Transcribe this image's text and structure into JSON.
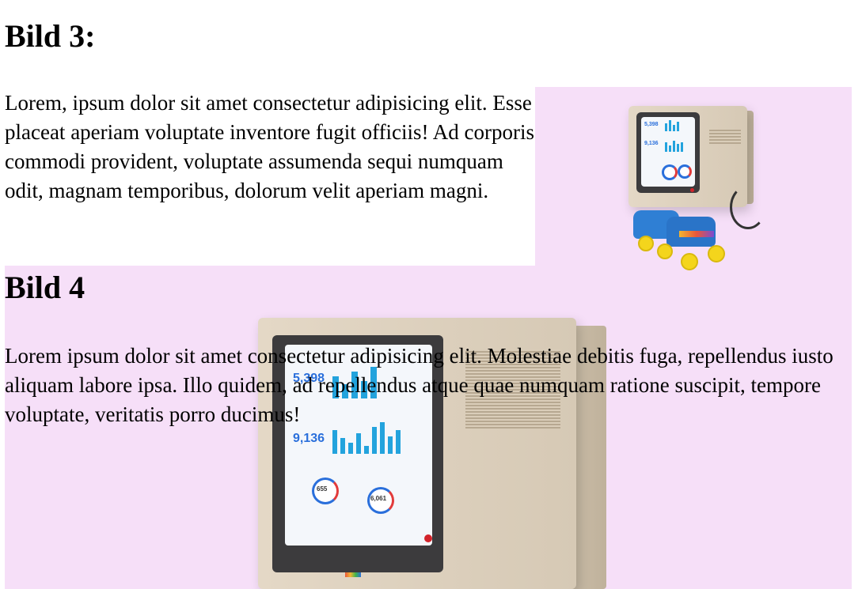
{
  "section3": {
    "heading": "Bild 3:",
    "text": "Lorem, ipsum dolor sit amet consectetur adipisicing elit. Esse placeat aperiam voluptate inventore fugit officiis! Ad corporis commodi provident, voluptate assumenda sequi numquam odit, magnam temporibus, dolorum velit aperiam magni."
  },
  "section4": {
    "heading": "Bild 4",
    "text": "Lorem ipsum dolor sit amet consectetur adipisicing elit. Molestiae debitis fuga, repellendus iusto aliquam labore ipsa. Illo quidem, ad repellendus atque quae numquam ratione suscipit, tempore voluptate, veritatis porro ducimus!"
  },
  "images": {
    "bild3": {
      "subject": "retro-computer-on-roller-skates",
      "background": "#f6dff8",
      "screen": {
        "stats": [
          "5,398",
          "9,136"
        ]
      }
    },
    "bild4": {
      "subject": "retro-crt-computer",
      "background": "#f6dff8",
      "screen": {
        "stats": [
          "5,398",
          "9,136",
          "655",
          "6,061"
        ]
      }
    }
  }
}
